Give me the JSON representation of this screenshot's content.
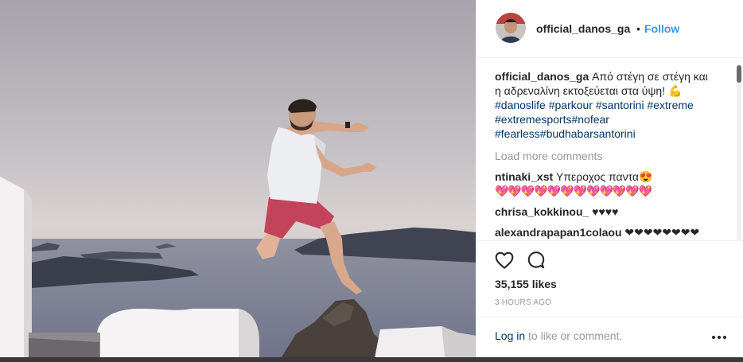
{
  "post": {
    "username": "official_danos_ga",
    "separator": "•",
    "follow_label": "Follow",
    "caption_user": "official_danos_ga",
    "caption_text": "Από στέγη σε στέγη και η αδρεναλίνη εκτοξεύεται στα ύψη!",
    "caption_emoji": "💪",
    "hashtags": [
      "#danoslife",
      "#parkour",
      "#santorini",
      "#extreme",
      "#extremesports",
      "#nofear",
      "#fearless",
      "#budhabarsantorini"
    ],
    "load_more": "Load more comments",
    "comments": [
      {
        "user": "ntinaki_xst",
        "text": "Υπεροχος παντα",
        "emoji": "😍",
        "hearts": "💖💖💖💖💖💖💖💖💖💖💖💖"
      },
      {
        "user": "chrisa_kokkinou_",
        "text": "♥♥♥♥",
        "emoji": "",
        "hearts": ""
      },
      {
        "user": "alexandrapapan1colaou",
        "text": "❤❤❤❤❤❤❤❤",
        "emoji": "",
        "hearts": ""
      }
    ],
    "likes": "35,155 likes",
    "time_ago": "3 HOURS AGO",
    "login_link": "Log in",
    "login_rest": " to like or comment."
  },
  "icons": {
    "like": "heart-outline-icon",
    "comment": "comment-bubble-icon",
    "more": "more-options-icon"
  },
  "colors": {
    "accent": "#3897f0",
    "hashtag": "#003569",
    "muted": "#999999",
    "text": "#262626"
  }
}
